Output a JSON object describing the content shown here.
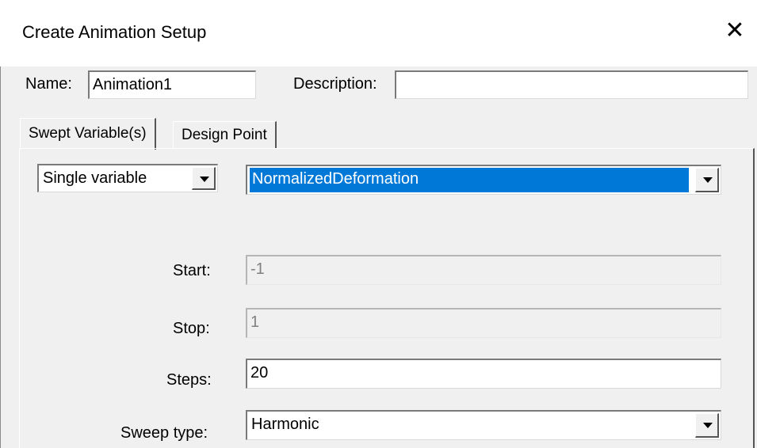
{
  "window": {
    "title": "Create Animation Setup",
    "close_glyph": "✕"
  },
  "name": {
    "label": "Name:",
    "value": "Animation1"
  },
  "description": {
    "label": "Description:",
    "value": ""
  },
  "tabs": [
    {
      "label": "Swept Variable(s)",
      "active": true
    },
    {
      "label": "Design Point",
      "active": false
    }
  ],
  "sweep": {
    "mode_value": "Single variable",
    "variable_value": "NormalizedDeformation",
    "start_label": "Start:",
    "start_value": "-1",
    "stop_label": "Stop:",
    "stop_value": "1",
    "steps_label": "Steps:",
    "steps_value": "20",
    "type_label": "Sweep type:",
    "type_value": "Harmonic"
  },
  "icons": {
    "close": "close-icon",
    "dropdown": "chevron-down-icon"
  },
  "colors": {
    "selection": "#0078d7",
    "dialog_bg": "#f0f0f0",
    "titlebar_bg": "#ffffff"
  }
}
